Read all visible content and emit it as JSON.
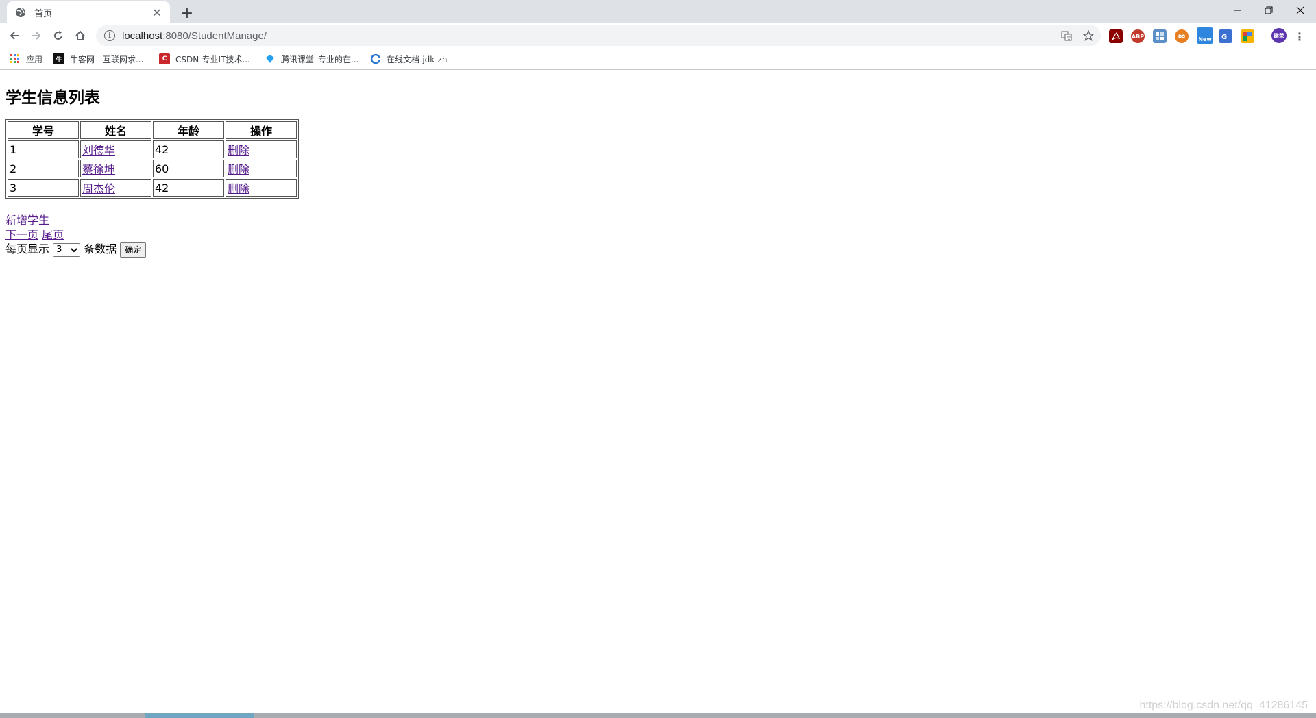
{
  "browser": {
    "tab_title": "首页",
    "url_host": "localhost",
    "url_rest": ":8080/StudentManage/",
    "bookmarks": [
      {
        "label": "应用",
        "color": "#e8453c"
      },
      {
        "label": "牛客网 - 互联网求...",
        "color": "#111111"
      },
      {
        "label": "CSDN-专业IT技术...",
        "color": "#c9282d"
      },
      {
        "label": "腾讯课堂_专业的在...",
        "color": "#23a0f0"
      },
      {
        "label": "在线文档-jdk-zh",
        "color": "#2a78d6"
      }
    ],
    "extension_labels": [
      "ABP",
      "New",
      "建荣"
    ]
  },
  "page": {
    "heading": "学生信息列表",
    "table": {
      "headers": [
        "学号",
        "姓名",
        "年龄",
        "操作"
      ],
      "rows": [
        {
          "id": "1",
          "name": "刘德华",
          "age": "42",
          "action": "删除"
        },
        {
          "id": "2",
          "name": "蔡徐坤",
          "age": "60",
          "action": "删除"
        },
        {
          "id": "3",
          "name": "周杰伦",
          "age": "42",
          "action": "删除"
        }
      ]
    },
    "add_link": "新增学生",
    "next_link": "下一页",
    "last_link": "尾页",
    "per_page_prefix": "每页显示",
    "per_page_value": "3",
    "per_page_suffix": "条数据",
    "confirm_button": "确定"
  },
  "watermark": "https://blog.csdn.net/qq_41286145"
}
